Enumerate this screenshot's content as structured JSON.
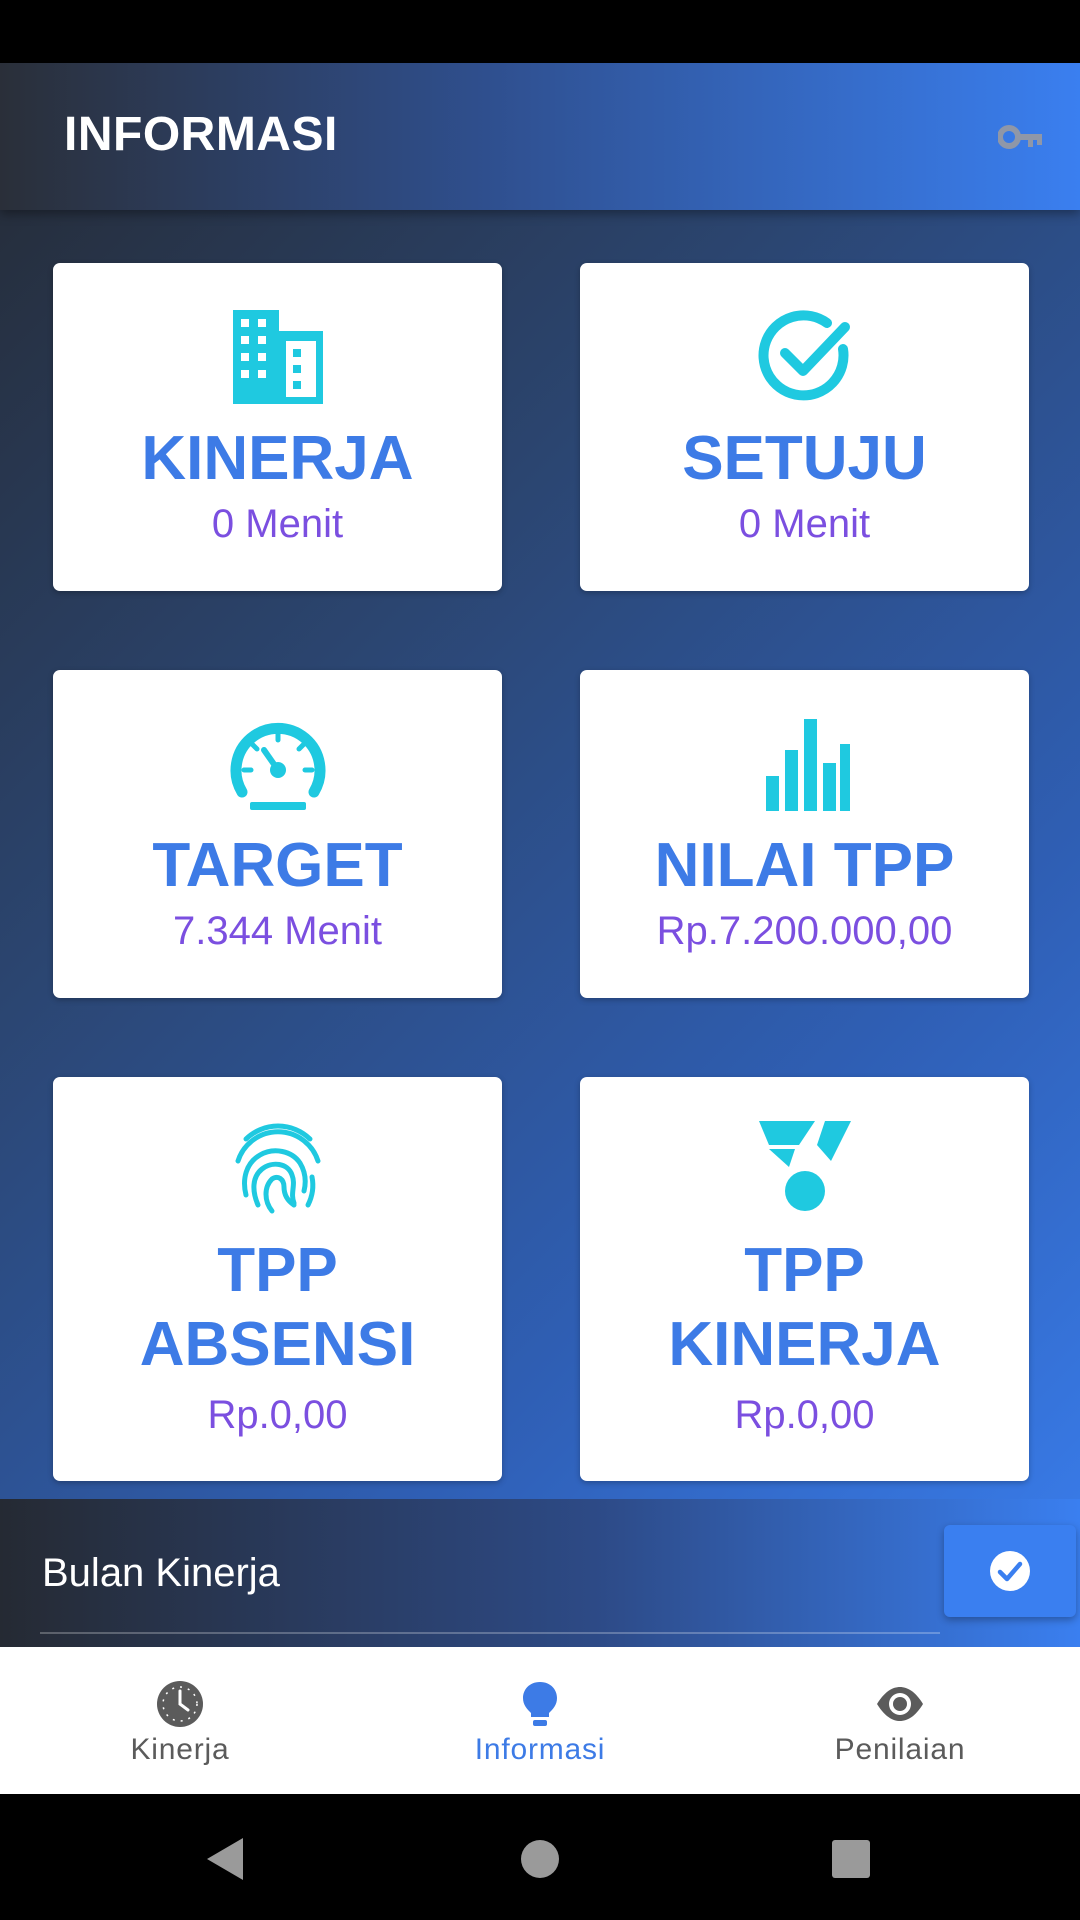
{
  "app_bar": {
    "title": "INFORMASI",
    "action_icon": "key-icon"
  },
  "cards": [
    {
      "title": "KINERJA",
      "value": "0 Menit",
      "icon": "building-icon"
    },
    {
      "title": "SETUJU",
      "value": "0 Menit",
      "icon": "check-circle-icon"
    },
    {
      "title": "TARGET",
      "value": "7.344 Menit",
      "icon": "speedometer-icon"
    },
    {
      "title": "NILAI TPP",
      "value": "Rp.7.200.000,00",
      "icon": "bar-chart-icon"
    },
    {
      "title_line1": "TPP",
      "title_line2": "ABSENSI",
      "value": "Rp.0,00",
      "icon": "fingerprint-icon"
    },
    {
      "title_line1": "TPP",
      "title_line2": "KINERJA",
      "value": "Rp.0,00",
      "icon": "medal-icon"
    }
  ],
  "bottom_panel": {
    "label": "Bulan Kinerja",
    "button_icon": "check-circle-icon"
  },
  "bottom_nav": [
    {
      "label": "Kinerja",
      "icon": "clock-icon",
      "active": false
    },
    {
      "label": "Informasi",
      "icon": "lightbulb-icon",
      "active": true
    },
    {
      "label": "Penilaian",
      "icon": "eye-icon",
      "active": false
    }
  ],
  "colors": {
    "accent": "#3d7be6",
    "value_text": "#7b4fe0",
    "icon_cyan": "#1fc9e0"
  }
}
